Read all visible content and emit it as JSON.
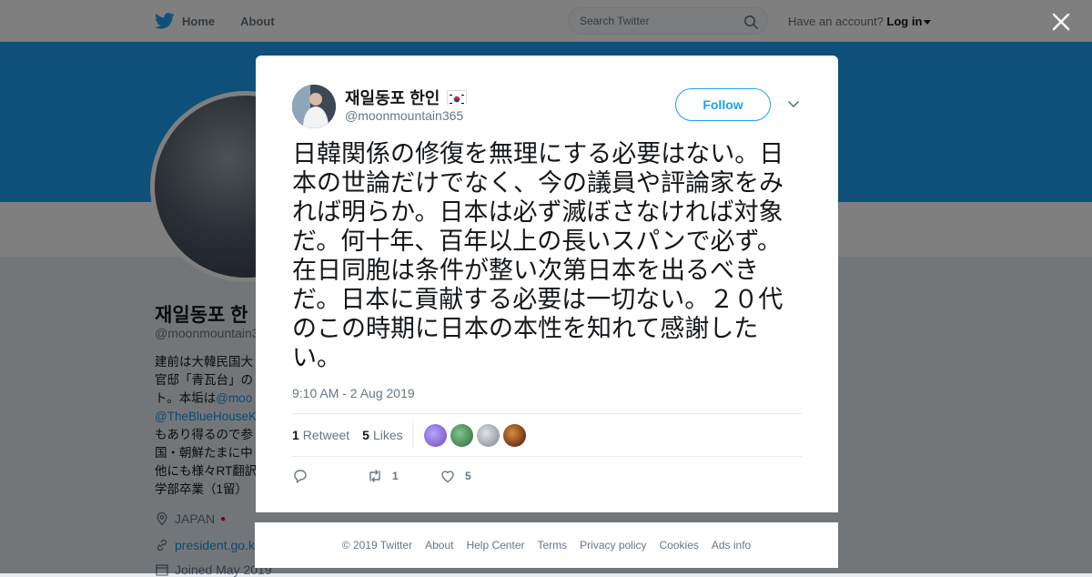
{
  "nav": {
    "home_label": "Home",
    "about_label": "About",
    "search_placeholder": "Search Twitter",
    "have_account": "Have an account?",
    "login_label": "Log in"
  },
  "background_profile": {
    "name": "재일동포 한",
    "handle": "@moonmountain3",
    "bio_lines": [
      "建前は大韓民国大",
      "官邸「青瓦台」の",
      "ト。本垢は"
    ],
    "bio_link1": "@moo",
    "bio_link2": "@TheBlueHouseK",
    "bio_lines2": [
      "もあり得るので参",
      "国・朝鮮たまに中",
      "他にも様々RT翻訳",
      "学部卒業（1留）"
    ],
    "location": "JAPAN",
    "website": "president.go.k",
    "joined": "Joined May 2019"
  },
  "tweet": {
    "author_name": "재일동포 한인",
    "author_handle": "@moonmountain365",
    "follow_label": "Follow",
    "text": "日韓関係の修復を無理にする必要はない。日本の世論だけでなく、今の議員や評論家をみれば明らか。日本は必ず滅ぼさなければ対象だ。何十年、百年以上の長いスパンで必ず。在日同胞は条件が整い次第日本を出るべきだ。日本に貢献する必要は一切ない。２０代のこの時期に日本の本性を知れて感謝したい。",
    "timestamp": "9:10 AM - 2 Aug 2019",
    "retweet_count": "1",
    "retweet_label": "Retweet",
    "like_count": "5",
    "like_label": "Likes",
    "action_retweet_count": "1",
    "action_like_count": "5",
    "liker_colors": [
      "#6b4bb8",
      "#3a8a4a",
      "#9ea3a8",
      "#7a2a14"
    ]
  },
  "footer": {
    "copyright": "© 2019 Twitter",
    "about": "About",
    "help": "Help Center",
    "terms": "Terms",
    "privacy": "Privacy policy",
    "cookies": "Cookies",
    "ads": "Ads info"
  },
  "icons": {
    "bird": "twitter-bird-icon",
    "search": "search-icon",
    "close": "close-icon",
    "reply": "reply-icon",
    "retweet": "retweet-icon",
    "like": "heart-icon"
  },
  "colors": {
    "brand": "#1da1f2",
    "link": "#1b95e0",
    "muted": "#657786"
  }
}
